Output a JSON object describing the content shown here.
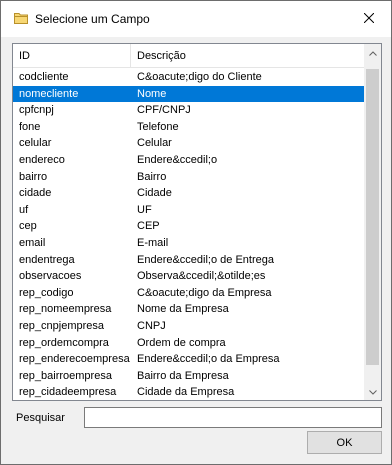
{
  "window": {
    "title": "Selecione um Campo",
    "title_icon": "folder-icon",
    "close_icon": "close-icon"
  },
  "list": {
    "columns": [
      "ID",
      "Descrição"
    ],
    "selected_index": 1,
    "rows": [
      {
        "id": "codcliente",
        "desc": "C&oacute;digo do Cliente"
      },
      {
        "id": "nomecliente",
        "desc": "Nome"
      },
      {
        "id": "cpfcnpj",
        "desc": "CPF/CNPJ"
      },
      {
        "id": "fone",
        "desc": "Telefone"
      },
      {
        "id": "celular",
        "desc": "Celular"
      },
      {
        "id": "endereco",
        "desc": "Endere&ccedil;o"
      },
      {
        "id": "bairro",
        "desc": "Bairro"
      },
      {
        "id": "cidade",
        "desc": "Cidade"
      },
      {
        "id": "uf",
        "desc": "UF"
      },
      {
        "id": "cep",
        "desc": "CEP"
      },
      {
        "id": "email",
        "desc": "E-mail"
      },
      {
        "id": "endentrega",
        "desc": "Endere&ccedil;o de Entrega"
      },
      {
        "id": "observacoes",
        "desc": "Observa&ccedil;&otilde;es"
      },
      {
        "id": "rep_codigo",
        "desc": "C&oacute;digo da Empresa"
      },
      {
        "id": "rep_nomeempresa",
        "desc": "Nome da Empresa"
      },
      {
        "id": "rep_cnpjempresa",
        "desc": "CNPJ"
      },
      {
        "id": "rep_ordemcompra",
        "desc": "Ordem de compra"
      },
      {
        "id": "rep_enderecoempresa",
        "desc": "Endere&ccedil;o da Empresa"
      },
      {
        "id": "rep_bairroempresa",
        "desc": "Bairro da Empresa"
      },
      {
        "id": "rep_cidadeempresa",
        "desc": "Cidade da Empresa"
      }
    ]
  },
  "search": {
    "label": "Pesquisar",
    "value": ""
  },
  "ok_button": {
    "label": "OK"
  },
  "colors": {
    "selection": "#0078d7",
    "window_bg": "#f0f0f0",
    "folder": "#e8b94a"
  }
}
